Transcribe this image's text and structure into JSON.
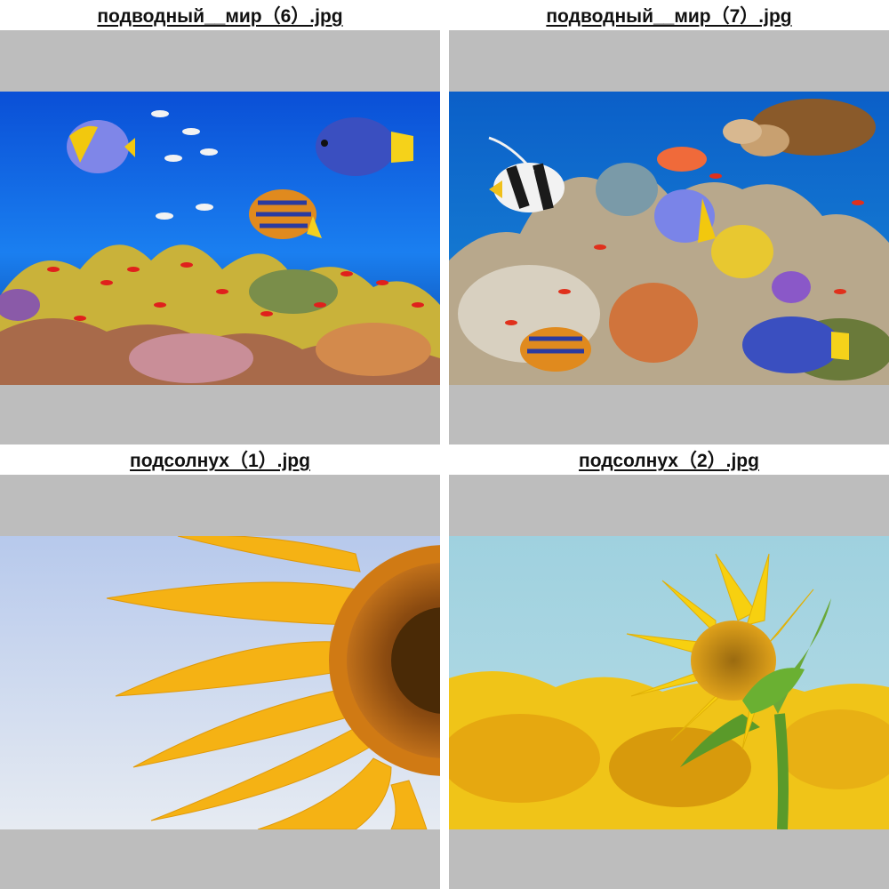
{
  "thumbnails": [
    {
      "filename": "подводный__мир（6）.jpg",
      "image": "underwater-reef-photo"
    },
    {
      "filename": "подводный__мир（7）.jpg",
      "image": "coral-reef-turtle-photo"
    },
    {
      "filename": "подсолнух（1）.jpg",
      "image": "sunflower-closeup-photo"
    },
    {
      "filename": "подсолнух（2）.jpg",
      "image": "sunflower-field-photo"
    }
  ],
  "colors": {
    "frame_background": "#bdbdbd",
    "page_background": "#ffffff",
    "caption_text": "#111111"
  }
}
